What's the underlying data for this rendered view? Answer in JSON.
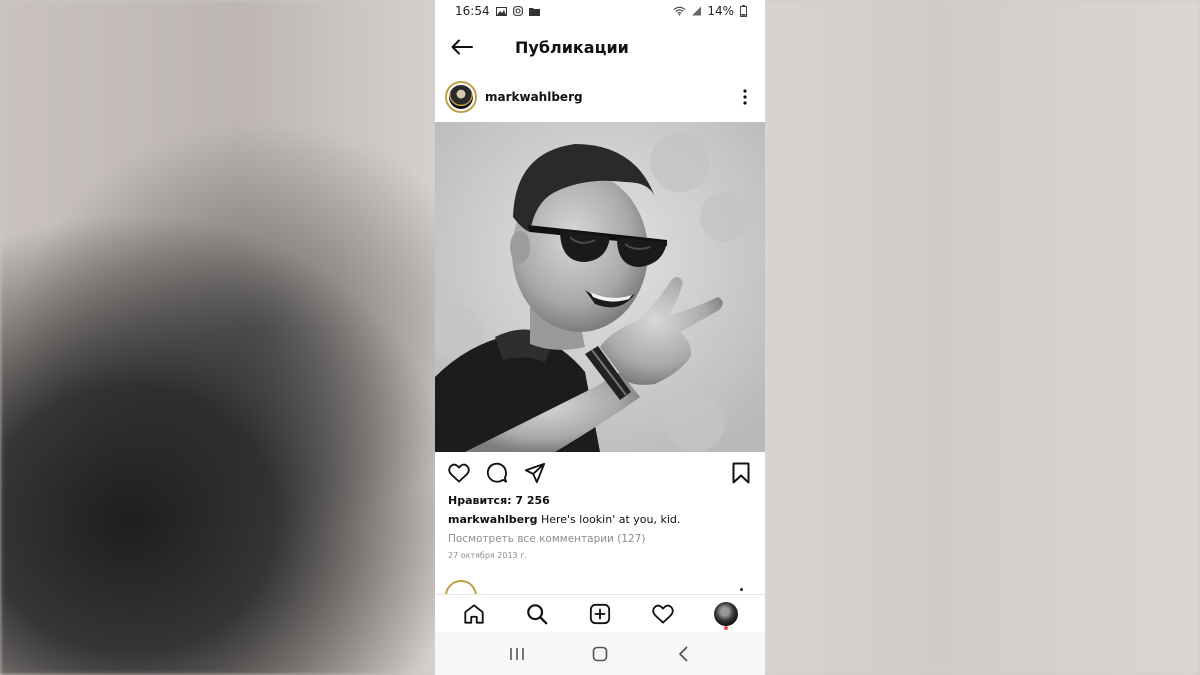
{
  "status_bar": {
    "time": "16:54",
    "battery": "14%",
    "icons": [
      "gallery-icon",
      "instagram-icon",
      "folder-icon",
      "wifi-icon",
      "signal-icon",
      "battery-icon"
    ]
  },
  "header": {
    "title": "Публикации"
  },
  "post": {
    "username": "markwahlberg",
    "likes_text": "Нравится: 7 256",
    "caption_username": "markwahlberg",
    "caption_text": " Here's lookin' at you, kid.",
    "comments_link": "Посмотреть все комментарии (127)",
    "date": "27 октября 2013 г."
  },
  "bottom_nav": {
    "items": [
      "home-icon",
      "search-icon",
      "new-post-icon",
      "activity-heart-icon",
      "profile-avatar"
    ],
    "accent": "#ed4956"
  },
  "colors": {
    "text": "#111111",
    "muted": "#8e8e8e",
    "story_ring": "#c2a04a"
  }
}
